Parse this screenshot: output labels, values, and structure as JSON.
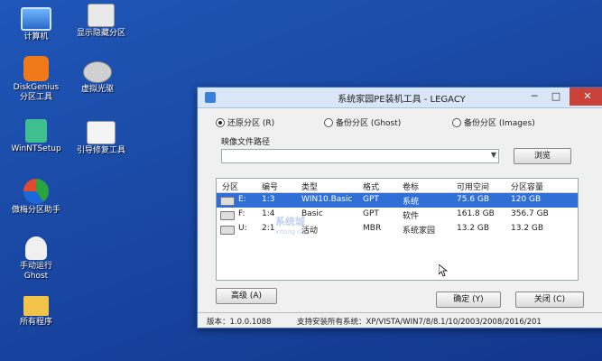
{
  "desktop": {
    "icons": [
      {
        "label": "计算机"
      },
      {
        "label": "显示隐藏分区"
      },
      {
        "label": "DiskGenius\n分区工具"
      },
      {
        "label": "虚拟光驱"
      },
      {
        "label": "WinNTSetup"
      },
      {
        "label": "引导修复工具"
      },
      {
        "label": "傲梅分区助手"
      },
      {
        "label": "手动运行\nGhost"
      },
      {
        "label": "所有程序"
      }
    ]
  },
  "window": {
    "title": "系统家园PE装机工具 - LEGACY",
    "controls": {
      "minimize": "─",
      "maximize": "□",
      "close": "✕"
    },
    "modes": {
      "restore": "还原分区 (R)",
      "backup_ghost": "备份分区 (Ghost)",
      "backup_images": "备份分区 (Images)"
    },
    "path_label": "映像文件路径",
    "path_value": "",
    "browse_button": "浏览",
    "table": {
      "headers": [
        "分区",
        "编号",
        "类型",
        "格式",
        "卷标",
        "可用空间",
        "分区容量"
      ],
      "rows": [
        [
          "E:",
          "1:3",
          "WIN10.Basic",
          "GPT",
          "系统",
          "75.6 GB",
          "120 GB"
        ],
        [
          "F:",
          "1:4",
          "Basic",
          "GPT",
          "软件",
          "161.8 GB",
          "356.7 GB"
        ],
        [
          "U:",
          "2:1",
          "活动",
          "MBR",
          "系统家园",
          "13.2 GB",
          "13.2 GB"
        ]
      ]
    },
    "advanced_button": "高级 (A)",
    "ok_button": "确定 (Y)",
    "close_button": "关闭 (C)",
    "version": "版本：1.0.0.1088",
    "support_text": "支持安装所有系统：XP/VISTA/WIN7/8/8.1/10/2003/2008/2016/201"
  },
  "watermark": {
    "brand": "系统城",
    "sub": "xitong city"
  },
  "colors": {
    "desktop_blue": "#1a4aa6",
    "selection_blue": "#2f6fd6",
    "close_red": "#c9423a"
  }
}
